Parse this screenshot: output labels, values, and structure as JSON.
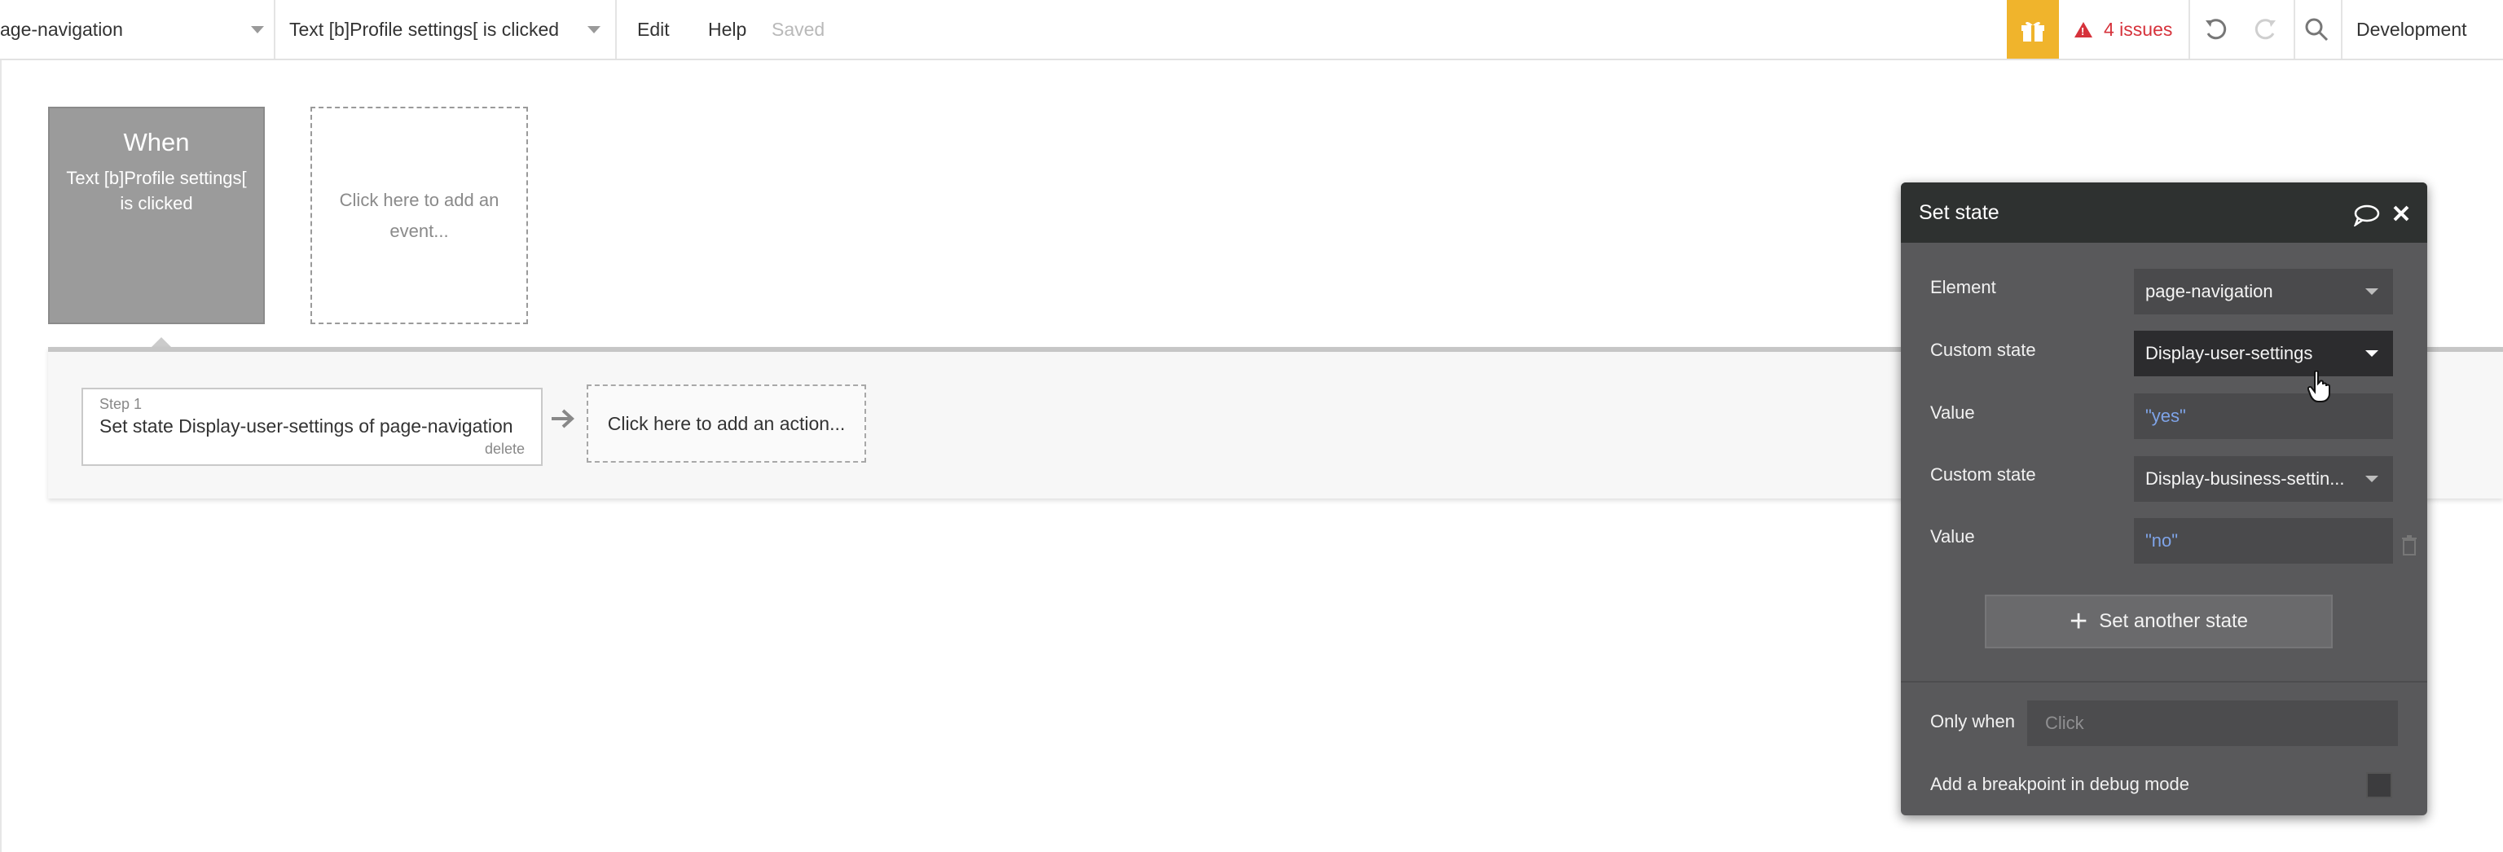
{
  "toolbar": {
    "page_select": "age-navigation",
    "event_select": "Text [b]Profile settings[ is clicked",
    "edit": "Edit",
    "help": "Help",
    "saved": "Saved",
    "issues": "4 issues",
    "environment": "Development"
  },
  "workflow": {
    "when_title": "When",
    "when_subtitle": "Text [b]Profile settings[ is clicked",
    "add_event": "Click here to add an event...",
    "step_number": "Step 1",
    "step_title": "Set state Display-user-settings of page-navigation",
    "step_delete": "delete",
    "add_action": "Click here to add an action..."
  },
  "panel": {
    "title": "Set state",
    "element_label": "Element",
    "element_value": "page-navigation",
    "custom_state_label": "Custom state",
    "custom_state_1": "Display-user-settings",
    "value_label": "Value",
    "value_1": "\"yes\"",
    "custom_state_2": "Display-business-settin...",
    "value_2": "\"no\"",
    "set_another": "Set another state",
    "only_when_label": "Only when",
    "only_when_placeholder": "Click",
    "breakpoint_label": "Add a breakpoint in debug mode",
    "breakpoint_checked": false
  },
  "colors": {
    "accent_gift": "#f0b42c",
    "issues_red": "#d6323b",
    "panel_bg": "#59595b",
    "panel_header": "#2e3130",
    "value_blue": "#7fa4e8"
  },
  "icons": [
    "gift-icon",
    "warning-icon",
    "undo-icon",
    "redo-icon",
    "search-icon",
    "comment-icon",
    "close-icon",
    "arrow-right-icon",
    "plus-icon",
    "trash-icon",
    "hand-cursor-icon"
  ]
}
